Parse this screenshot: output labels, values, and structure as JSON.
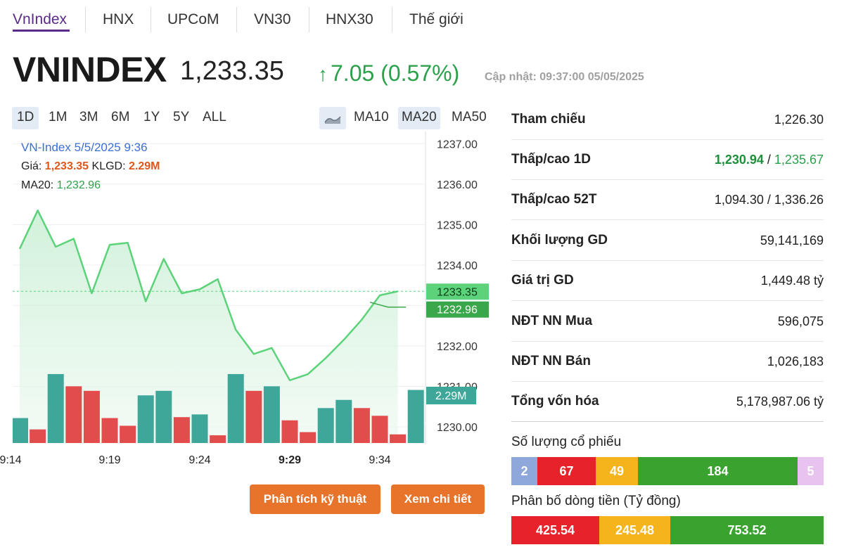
{
  "tabs": [
    {
      "label": "VnIndex",
      "active": true
    },
    {
      "label": "HNX",
      "active": false
    },
    {
      "label": "UPCoM",
      "active": false
    },
    {
      "label": "VN30",
      "active": false
    },
    {
      "label": "HNX30",
      "active": false
    },
    {
      "label": "Thế giới",
      "active": false
    }
  ],
  "header": {
    "name": "VNINDEX",
    "price": "1,233.35",
    "change_arrow": "↑",
    "change": "7.05 (0.57%)",
    "update": "Cập nhật: 09:37:00 05/05/2025"
  },
  "ranges": [
    "1D",
    "1M",
    "3M",
    "6M",
    "1Y",
    "5Y",
    "ALL"
  ],
  "active_range": "1D",
  "ma_buttons": [
    {
      "label": "MA10",
      "active": false
    },
    {
      "label": "MA20",
      "active": true
    },
    {
      "label": "MA50",
      "active": false
    }
  ],
  "tooltip": {
    "title": "VN-Index 5/5/2025 9:36",
    "price_label": "Giá: ",
    "price_value": "1,233.35",
    "vol_label": " KLGD: ",
    "vol_value": "2.29M",
    "ma_label": "MA20: ",
    "ma_value": "1,232.96"
  },
  "chart_data": {
    "type": "line",
    "x_ticks": [
      "9:14",
      "9:19",
      "9:24",
      "9:29",
      "9:34"
    ],
    "y_ticks": [
      "1237.00",
      "1236.00",
      "1235.00",
      "1234.00",
      "1233.00",
      "1232.00",
      "1231.00",
      "1230.00"
    ],
    "ylim": [
      1229.6,
      1237.3
    ],
    "price": [
      1234.4,
      1235.35,
      1234.45,
      1234.65,
      1233.3,
      1234.5,
      1234.55,
      1233.1,
      1234.15,
      1233.3,
      1233.4,
      1233.65,
      1232.4,
      1231.8,
      1231.95,
      1231.15,
      1231.3,
      1231.7,
      1232.15,
      1232.65,
      1233.25,
      1233.35
    ],
    "ma20": [
      {
        "i": 20,
        "v": 1233.08
      },
      {
        "i": 21,
        "v": 1232.96
      },
      {
        "i": 22,
        "v": 1232.96
      }
    ],
    "volume_m": [
      0.55,
      0.3,
      1.52,
      1.25,
      1.15,
      0.55,
      0.38,
      1.05,
      1.15,
      0.57,
      0.63,
      0.17,
      1.52,
      1.15,
      1.25,
      0.5,
      0.24,
      0.77,
      0.95,
      0.77,
      0.6,
      0.19,
      1.17
    ],
    "volume_up": [
      true,
      false,
      true,
      false,
      false,
      false,
      false,
      true,
      true,
      false,
      true,
      false,
      true,
      false,
      true,
      false,
      false,
      true,
      true,
      false,
      false,
      false,
      true
    ],
    "last_price_label": "1233.35",
    "last_ma_label": "1232.96",
    "last_volume_label": "2.29M",
    "colors": {
      "price": "#5cd37a",
      "up": "#3fa69a",
      "down": "#e34c4c",
      "ma": "#3aa84a"
    }
  },
  "actions": {
    "technical": "Phân tích kỹ thuật",
    "detail": "Xem chi tiết"
  },
  "stats": [
    {
      "label": "Tham chiếu",
      "value": "1,226.30"
    },
    {
      "label": "Thấp/cao 1D",
      "low": "1,230.94",
      "sep": " / ",
      "high": "1,235.67"
    },
    {
      "label": "Thấp/cao 52T",
      "value": "1,094.30 / 1,336.26"
    },
    {
      "label": "Khối lượng GD",
      "value": "59,141,169"
    },
    {
      "label": "Giá trị GD",
      "value": "1,449.48 tỷ"
    },
    {
      "label": "NĐT NN Mua",
      "value": "596,075"
    },
    {
      "label": "NĐT NN Bán",
      "value": "1,026,183"
    },
    {
      "label": "Tổng vốn hóa",
      "value": "5,178,987.06 tỷ"
    }
  ],
  "stock_count": {
    "title": "Số lượng cổ phiếu",
    "segments": [
      {
        "value": "2",
        "color": "#8ea8dc"
      },
      {
        "value": "67",
        "color": "#e8222a"
      },
      {
        "value": "49",
        "color": "#f5b41b"
      },
      {
        "value": "184",
        "color": "#3aa32f"
      },
      {
        "value": "5",
        "color": "#e9c3f0"
      }
    ]
  },
  "money_flow": {
    "title": "Phân bố dòng tiền (Tỷ đồng)",
    "segments": [
      {
        "value": "425.54",
        "color": "#e8222a"
      },
      {
        "value": "245.48",
        "color": "#f5b41b"
      },
      {
        "value": "753.52",
        "color": "#3aa32f"
      }
    ]
  }
}
